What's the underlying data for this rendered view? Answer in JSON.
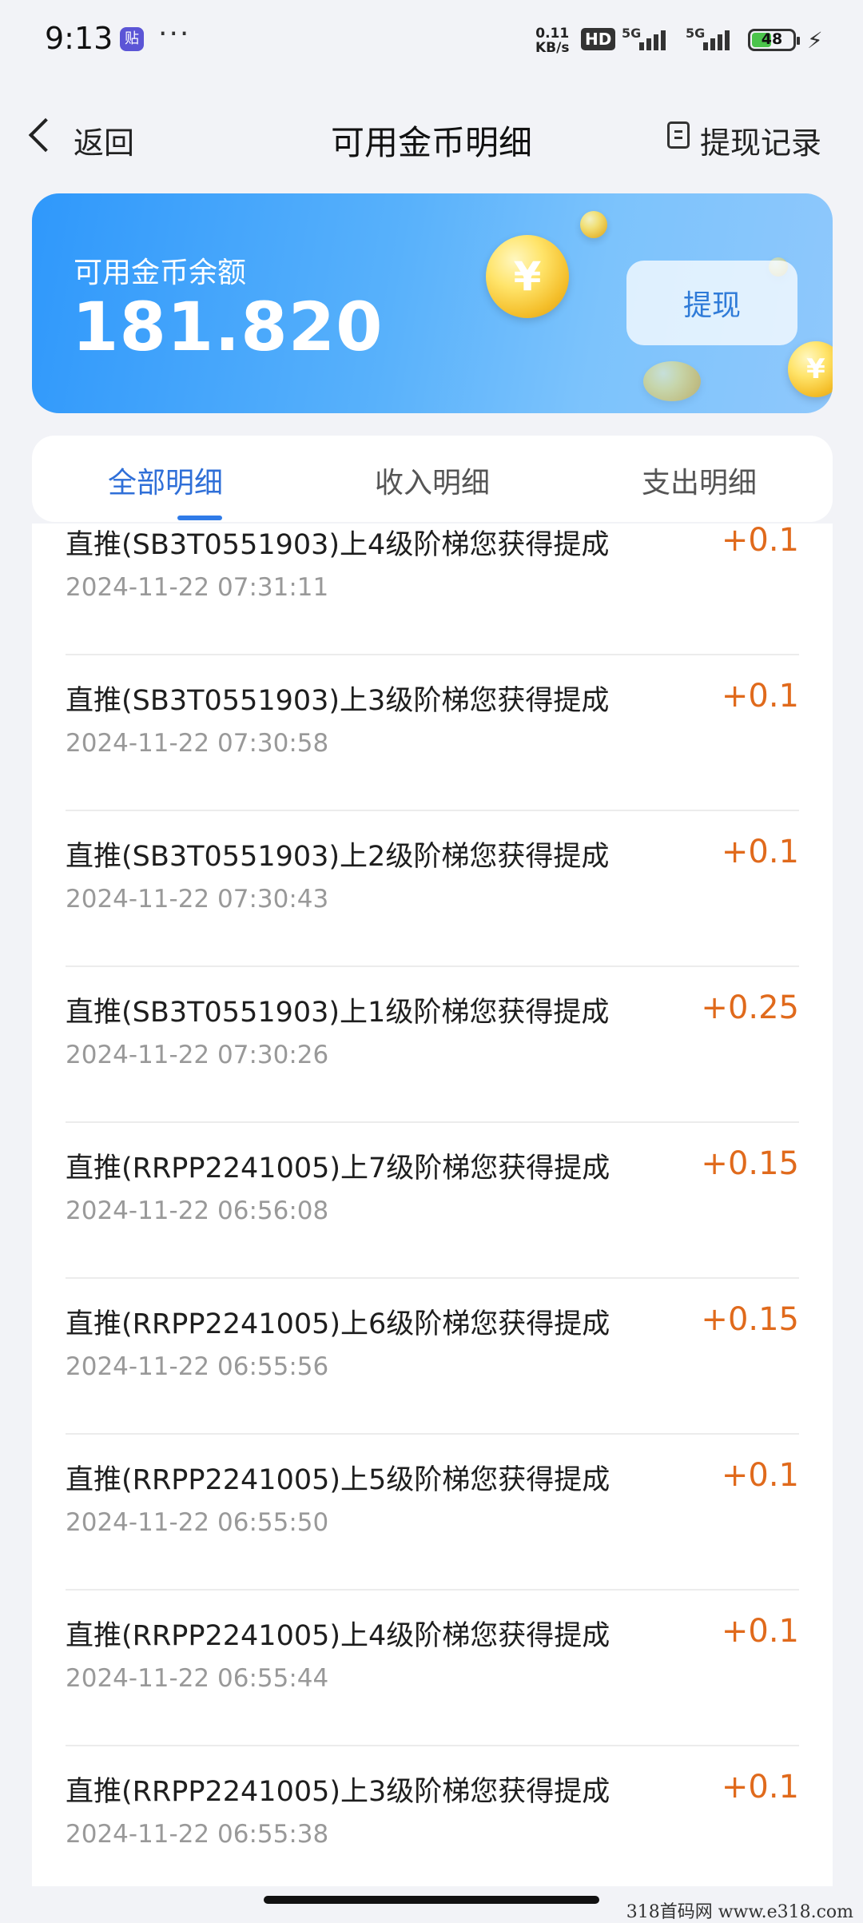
{
  "status_bar": {
    "time": "9:13",
    "app_badge": "贴",
    "more": "···",
    "net_speed_value": "0.11",
    "net_speed_unit": "KB/s",
    "hd": "HD",
    "sim1": "5G",
    "sim2": "5G",
    "battery": "48",
    "battery_color": "#4bc44b"
  },
  "nav": {
    "back_label": "返回",
    "title": "可用金币明细",
    "record_label": "提现记录"
  },
  "balance": {
    "label": "可用金币余额",
    "value": "181.820",
    "withdraw_label": "提现",
    "coin_symbol": "¥"
  },
  "tabs": [
    {
      "label": "全部明细",
      "active": true
    },
    {
      "label": "收入明细",
      "active": false
    },
    {
      "label": "支出明细",
      "active": false
    }
  ],
  "accent_color": "#2f6fd8",
  "amount_color": "#e06a1c",
  "transactions": [
    {
      "title": "直推(SB3T0551903)上4级阶梯您获得提成",
      "time": "2024-11-22 07:31:11",
      "amount": "+0.1"
    },
    {
      "title": "直推(SB3T0551903)上3级阶梯您获得提成",
      "time": "2024-11-22 07:30:58",
      "amount": "+0.1"
    },
    {
      "title": "直推(SB3T0551903)上2级阶梯您获得提成",
      "time": "2024-11-22 07:30:43",
      "amount": "+0.1"
    },
    {
      "title": "直推(SB3T0551903)上1级阶梯您获得提成",
      "time": "2024-11-22 07:30:26",
      "amount": "+0.25"
    },
    {
      "title": "直推(RRPP2241005)上7级阶梯您获得提成",
      "time": "2024-11-22 06:56:08",
      "amount": "+0.15"
    },
    {
      "title": "直推(RRPP2241005)上6级阶梯您获得提成",
      "time": "2024-11-22 06:55:56",
      "amount": "+0.15"
    },
    {
      "title": "直推(RRPP2241005)上5级阶梯您获得提成",
      "time": "2024-11-22 06:55:50",
      "amount": "+0.1"
    },
    {
      "title": "直推(RRPP2241005)上4级阶梯您获得提成",
      "time": "2024-11-22 06:55:44",
      "amount": "+0.1"
    },
    {
      "title": "直推(RRPP2241005)上3级阶梯您获得提成",
      "time": "2024-11-22 06:55:38",
      "amount": "+0.1"
    }
  ],
  "watermark": "318首码网  www.e318.com"
}
